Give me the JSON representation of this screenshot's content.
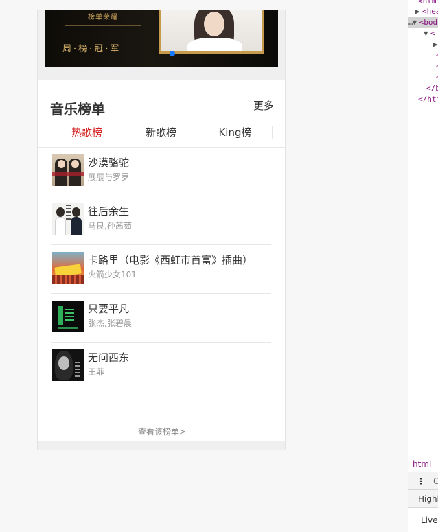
{
  "banner": {
    "logo_text": "榜单荣耀",
    "slogan": "周·榜·冠·军",
    "carousel_active_index": 0
  },
  "section": {
    "title": "音乐榜单",
    "more_label": "更多"
  },
  "tabs": [
    {
      "label": "热歌榜",
      "active": true
    },
    {
      "label": "新歌榜",
      "active": false
    },
    {
      "label": "King榜",
      "active": false
    }
  ],
  "songs": [
    {
      "name": "沙漠骆驼",
      "artist": "展展与罗罗"
    },
    {
      "name": "往后余生",
      "artist": "马良,孙茜茹"
    },
    {
      "name": "卡路里（电影《西虹市首富》插曲）",
      "artist": "火箭少女101"
    },
    {
      "name": "只要平凡",
      "artist": "张杰,张碧晨"
    },
    {
      "name": "无问西东",
      "artist": "王菲"
    }
  ],
  "view_all_label": "查看该榜单>",
  "devtools": {
    "lines": [
      "<html>",
      "<head>",
      "<body>",
      "<",
      "<",
      "<",
      "<",
      "</body>",
      "</html>"
    ],
    "crumb": "html",
    "toolbar_letter": "C",
    "tab_label": "Highl",
    "live_label": "Live"
  },
  "colors": {
    "active_tab": "#d41e1e",
    "carousel_dot": "#1677ff"
  }
}
